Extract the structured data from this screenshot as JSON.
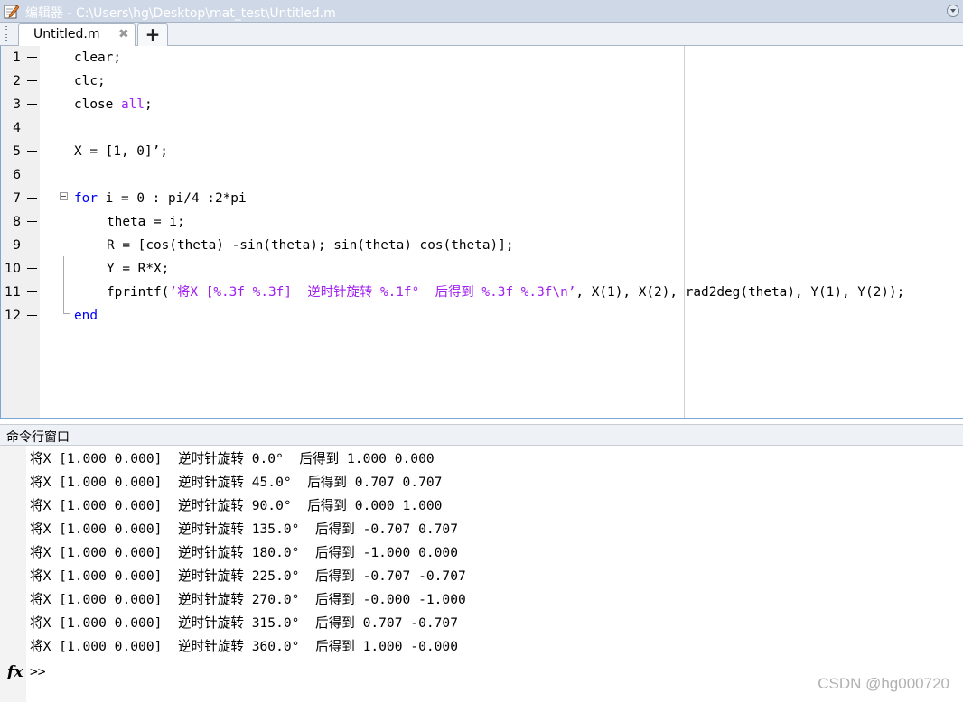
{
  "window": {
    "title": "编辑器 - C:\\Users\\hg\\Desktop\\mat_test\\Untitled.m",
    "tab_label": "Untitled.m",
    "close_glyph": "✖",
    "add_tab_glyph": "+"
  },
  "editor": {
    "lines": [
      {
        "num": "1",
        "tokens": [
          {
            "t": "clear;",
            "c": "plain"
          }
        ]
      },
      {
        "num": "2",
        "tokens": [
          {
            "t": "clc;",
            "c": "plain"
          }
        ]
      },
      {
        "num": "3",
        "tokens": [
          {
            "t": "close ",
            "c": "plain"
          },
          {
            "t": "all",
            "c": "str"
          },
          {
            "t": ";",
            "c": "plain"
          }
        ]
      },
      {
        "num": "4",
        "tokens": []
      },
      {
        "num": "5",
        "tokens": [
          {
            "t": "X = [1, 0]’;",
            "c": "plain"
          }
        ]
      },
      {
        "num": "6",
        "tokens": []
      },
      {
        "num": "7",
        "tokens": [
          {
            "t": "for",
            "c": "kw"
          },
          {
            "t": " i = 0 : pi/4 :2*pi",
            "c": "plain"
          }
        ]
      },
      {
        "num": "8",
        "tokens": [
          {
            "t": "theta = i;",
            "c": "plain"
          }
        ]
      },
      {
        "num": "9",
        "tokens": [
          {
            "t": "R = [cos(theta) -sin(theta); sin(theta) cos(theta)];",
            "c": "plain"
          }
        ]
      },
      {
        "num": "10",
        "tokens": [
          {
            "t": "Y = R*X;",
            "c": "plain"
          }
        ]
      },
      {
        "num": "11",
        "tokens": [
          {
            "t": "fprintf(",
            "c": "plain"
          },
          {
            "t": "’将X [%.3f %.3f]  逆时针旋转 %.1f°  后得到 %.3f %.3f\\n’",
            "c": "str"
          },
          {
            "t": ", X(1), X(2), rad2deg(theta), Y(1), Y(2));",
            "c": "plain"
          }
        ]
      },
      {
        "num": "12",
        "tokens": [
          {
            "t": "end",
            "c": "kw"
          }
        ]
      }
    ],
    "indented_lines": [
      8,
      9,
      10,
      11
    ],
    "dash_lines": [
      1,
      2,
      3,
      5,
      7,
      8,
      9,
      10,
      11,
      12
    ]
  },
  "command_window": {
    "title": "命令行窗口",
    "output": [
      "将X [1.000 0.000]  逆时针旋转 0.0°  后得到 1.000 0.000",
      "将X [1.000 0.000]  逆时针旋转 45.0°  后得到 0.707 0.707",
      "将X [1.000 0.000]  逆时针旋转 90.0°  后得到 0.000 1.000",
      "将X [1.000 0.000]  逆时针旋转 135.0°  后得到 -0.707 0.707",
      "将X [1.000 0.000]  逆时针旋转 180.0°  后得到 -1.000 0.000",
      "将X [1.000 0.000]  逆时针旋转 225.0°  后得到 -0.707 -0.707",
      "将X [1.000 0.000]  逆时针旋转 270.0°  后得到 -0.000 -1.000",
      "将X [1.000 0.000]  逆时针旋转 315.0°  后得到 0.707 -0.707",
      "将X [1.000 0.000]  逆时针旋转 360.0°  后得到 1.000 -0.000"
    ],
    "fx_label": "fx",
    "prompt": ">>"
  },
  "watermark": "CSDN @hg000720",
  "colors": {
    "keyword": "#0000ff",
    "string": "#a020f0",
    "titlebar": "#cfd8e6"
  }
}
